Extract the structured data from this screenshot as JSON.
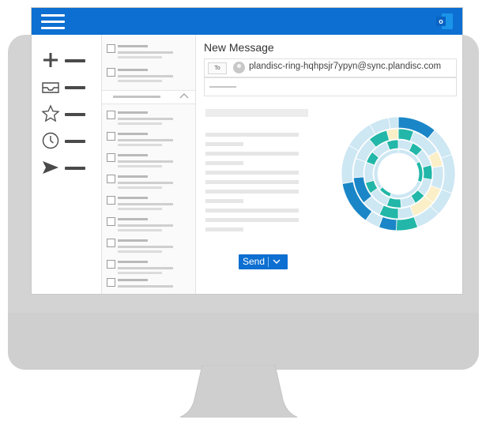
{
  "app": {
    "menu_icon": "hamburger-icon",
    "app_icon": "outlook-icon",
    "app_icon_letter": "o",
    "accent_color": "#0c6fd1"
  },
  "nav": {
    "items": [
      {
        "icon": "plus-icon"
      },
      {
        "icon": "inbox-icon"
      },
      {
        "icon": "star-icon"
      },
      {
        "icon": "clock-icon"
      },
      {
        "icon": "send-arrow-icon"
      }
    ]
  },
  "message_list": {
    "group_toggle_icon": "chevron-up-icon"
  },
  "compose": {
    "title": "New Message",
    "to_button_label": "To",
    "recipient": "plandisc-ring-hqhpsjr7ypyn@sync.plandisc.com",
    "send_label": "Send",
    "send_dropdown_icon": "chevron-down-icon",
    "embedded_image_icon": "circular-calendar-disc"
  },
  "colors": {
    "titlebar": "#0c6fd1",
    "disc_dark": "#1a86c7",
    "disc_teal": "#22b7a8",
    "disc_light": "#cde7f3",
    "disc_cream": "#fbefc8"
  }
}
